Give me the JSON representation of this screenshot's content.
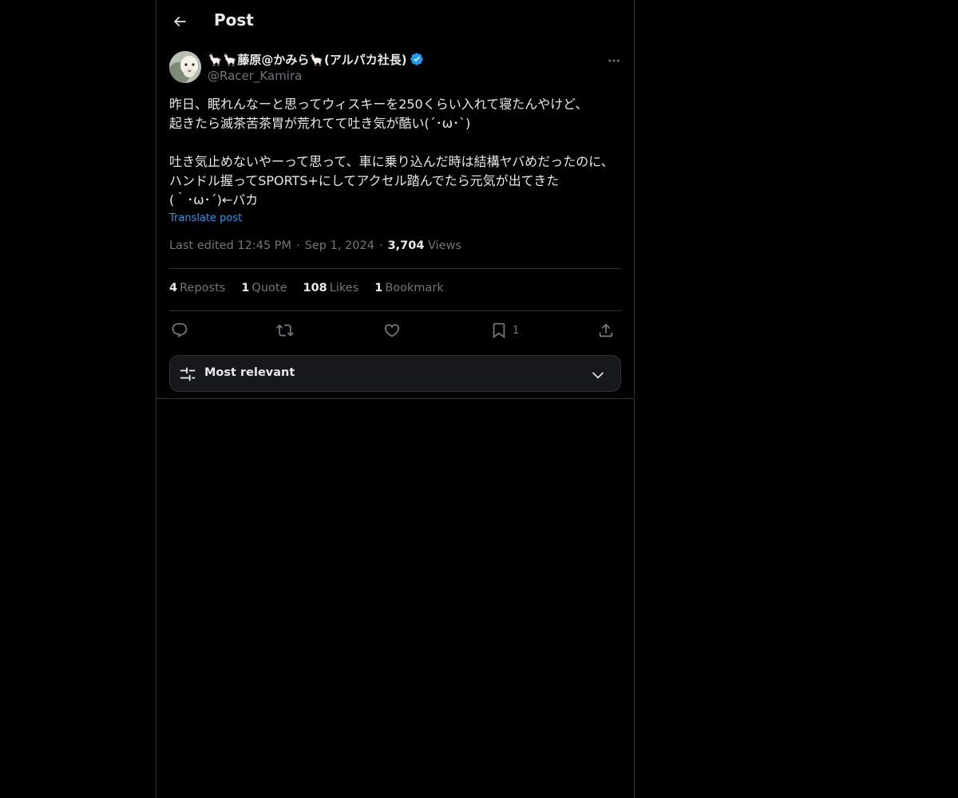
{
  "header": {
    "title": "Post"
  },
  "author": {
    "display_name": "🦙🦙藤原@かみら🦙(アルパカ社長)",
    "handle": "@Racer_Kamira",
    "verified": true
  },
  "post": {
    "text": "昨日、眠れんなーと思ってウィスキーを250くらい入れて寝たんやけど、\n起きたら滅茶苦茶胃が荒れてて吐き気が酷い(´･ω･`)\n\n吐き気止めないやーって思って、車に乗り込んだ時は結構ヤバめだったのに、ハンドル握ってSPORTS+にしてアクセル踏んでたら元気が出てきた\n(｀･ω･´)←バカ",
    "translate_label": "Translate post",
    "edited_label": "Last edited 12:45 PM",
    "date": "Sep 1, 2024",
    "views_count": "3,704",
    "views_label": "Views"
  },
  "stats": {
    "reposts": {
      "count": "4",
      "label": "Reposts"
    },
    "quotes": {
      "count": "1",
      "label": "Quote"
    },
    "likes": {
      "count": "108",
      "label": "Likes"
    },
    "bookmarks": {
      "count": "1",
      "label": "Bookmark"
    }
  },
  "actions": {
    "bookmark_count": "1"
  },
  "sort": {
    "label": "Most relevant"
  },
  "colors": {
    "accent": "#1d9bf0",
    "background": "#000000",
    "muted": "#71767b",
    "text": "#e7e9ea"
  }
}
